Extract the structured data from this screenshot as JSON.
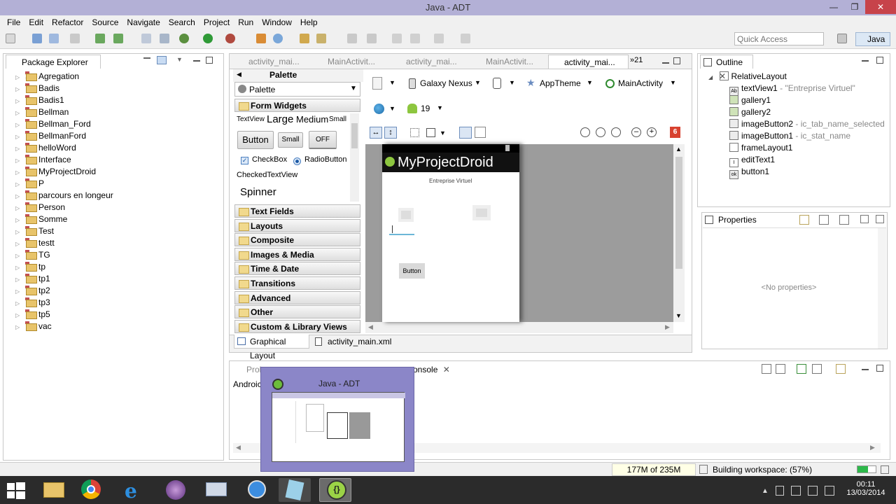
{
  "window": {
    "title": "Java - ADT"
  },
  "menu": [
    "File",
    "Edit",
    "Refactor",
    "Source",
    "Navigate",
    "Search",
    "Project",
    "Run",
    "Window",
    "Help"
  ],
  "quick_access": {
    "placeholder": "Quick Access"
  },
  "perspective": {
    "label": "Java"
  },
  "package_explorer": {
    "title": "Package Explorer",
    "items": [
      "Agregation",
      "Badis",
      "Badis1",
      "Bellman",
      "Bellman_Ford",
      "BellmanFord",
      "helloWord",
      "Interface",
      "MyProjectDroid",
      "P",
      "parcours en longeur",
      "Person",
      "Somme",
      "Test",
      "testt",
      "TG",
      "tp",
      "tp1",
      "tp2",
      "tp3",
      "tp5",
      "vac"
    ]
  },
  "editor_tabs": [
    "activity_mai...",
    "MainActivit...",
    "activity_mai...",
    "MainActivit...",
    "activity_mai..."
  ],
  "editor_tabs_overflow": "»21",
  "palette": {
    "header": "Palette",
    "dropdown": "Palette",
    "form_widgets": "Form Widgets",
    "textview": "TextView",
    "large": "Large",
    "medium": "Medium",
    "small": "Small",
    "button": "Button",
    "small_button": "Small",
    "toggle": "OFF",
    "checkbox": "CheckBox",
    "radiobutton": "RadioButton",
    "checkedtextview": "CheckedTextView",
    "spinner": "Spinner",
    "categories": [
      "Text Fields",
      "Layouts",
      "Composite",
      "Images & Media",
      "Time & Date",
      "Transitions",
      "Advanced",
      "Other",
      "Custom & Library Views"
    ]
  },
  "layout_toolbar": {
    "device": "Galaxy Nexus",
    "theme": "AppTheme",
    "activity": "MainActivity",
    "api": "19",
    "error_count": "6"
  },
  "device_preview": {
    "app_title": "MyProjectDroid",
    "text_view": "Entreprise Virtuel",
    "button": "Button"
  },
  "editor_bottom_tabs": [
    "Graphical Layout",
    "activity_main.xml"
  ],
  "outline": {
    "title": "Outline",
    "root": "RelativeLayout",
    "items": [
      {
        "name": "textView1",
        "detail": " - \"Entreprise Virtuel\""
      },
      {
        "name": "gallery1",
        "detail": ""
      },
      {
        "name": "gallery2",
        "detail": ""
      },
      {
        "name": "imageButton2",
        "detail": " - ic_tab_name_selected"
      },
      {
        "name": "imageButton1",
        "detail": " - ic_stat_name"
      },
      {
        "name": "frameLayout1",
        "detail": ""
      },
      {
        "name": "editText1",
        "detail": ""
      },
      {
        "name": "button1",
        "detail": ""
      }
    ]
  },
  "properties": {
    "title": "Properties",
    "empty": "<No properties>"
  },
  "bottom_panel": {
    "tab_problems": "Prob",
    "tab_console": "onsole",
    "content": "Androic"
  },
  "thumbnail": {
    "title": "Java - ADT"
  },
  "status": {
    "memory": "177M of 235M",
    "building": "Building workspace: (57%)",
    "progress": 0.57
  },
  "tray": {
    "time": "00:11",
    "date": "13/03/2014"
  }
}
